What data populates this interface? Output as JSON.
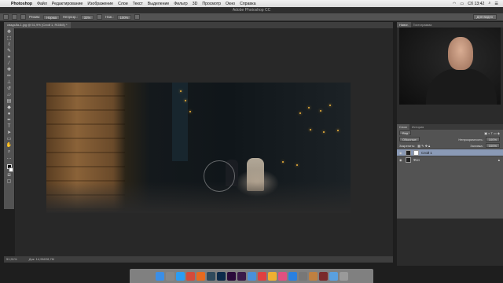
{
  "menubar": {
    "app_name": "Photoshop",
    "items": [
      "Файл",
      "Редактирование",
      "Изображение",
      "Слои",
      "Текст",
      "Выделение",
      "Фильтр",
      "3D",
      "Просмотр",
      "Окно",
      "Справка"
    ],
    "time": "Сб 13:42"
  },
  "window": {
    "title": "Adobe Photoshop CC"
  },
  "options": {
    "mode_label": "Режим:",
    "mode_value": "Норма",
    "opacity_label": "Непрозр.:",
    "opacity_value": "33%",
    "flow_label": "Наж.:",
    "flow_value": "100%",
    "workspace": "Для видео"
  },
  "document": {
    "tab_title": "свадьба-1.jpg @ 51,9% (Слой 1, RGB/8) *"
  },
  "status": {
    "zoom": "51,91%",
    "doc_size": "Док: 14,9M/28,7M"
  },
  "panels": {
    "top_tabs": [
      "Навиг.",
      "Гистограмма"
    ],
    "layer_tabs": [
      "Слои",
      "История"
    ],
    "kind_label": "Вид",
    "blend_value": "Обычные",
    "opacity_label": "Непрозрачность:",
    "opacity_value": "100%",
    "lock_label": "Закрепить:",
    "fill_label": "Заливка:",
    "fill_value": "100%",
    "layers": [
      {
        "name": "Слой 1",
        "active": true
      },
      {
        "name": "Фон",
        "active": false
      }
    ]
  },
  "dock": {
    "apps": [
      {
        "name": "Finder",
        "color": "#3b8ee6"
      },
      {
        "name": "Launchpad",
        "color": "#888888"
      },
      {
        "name": "Safari",
        "color": "#2a9df4"
      },
      {
        "name": "Chrome",
        "color": "#d44a3a"
      },
      {
        "name": "Firefox",
        "color": "#e66a1f"
      },
      {
        "name": "Lr",
        "color": "#2f4a5c"
      },
      {
        "name": "Ps",
        "color": "#0b2a4a"
      },
      {
        "name": "Pr",
        "color": "#2a0a3a"
      },
      {
        "name": "Premiere",
        "color": "#3a1a4a"
      },
      {
        "name": "Mail",
        "color": "#4a90d9"
      },
      {
        "name": "Calendar",
        "color": "#e04040"
      },
      {
        "name": "Photos",
        "color": "#f0b030"
      },
      {
        "name": "Music",
        "color": "#e05080"
      },
      {
        "name": "App Store",
        "color": "#2a80e0"
      },
      {
        "name": "Settings",
        "color": "#777777"
      },
      {
        "name": "Contacts",
        "color": "#c08040"
      },
      {
        "name": "Video",
        "color": "#7a2a2a"
      },
      {
        "name": "Folder",
        "color": "#5aa0e0"
      },
      {
        "name": "Trash",
        "color": "#9a9a9a"
      }
    ]
  },
  "colors": {
    "accent": "#8a9ab6",
    "panel_bg": "#535353",
    "canvas_bg": "#282828"
  }
}
